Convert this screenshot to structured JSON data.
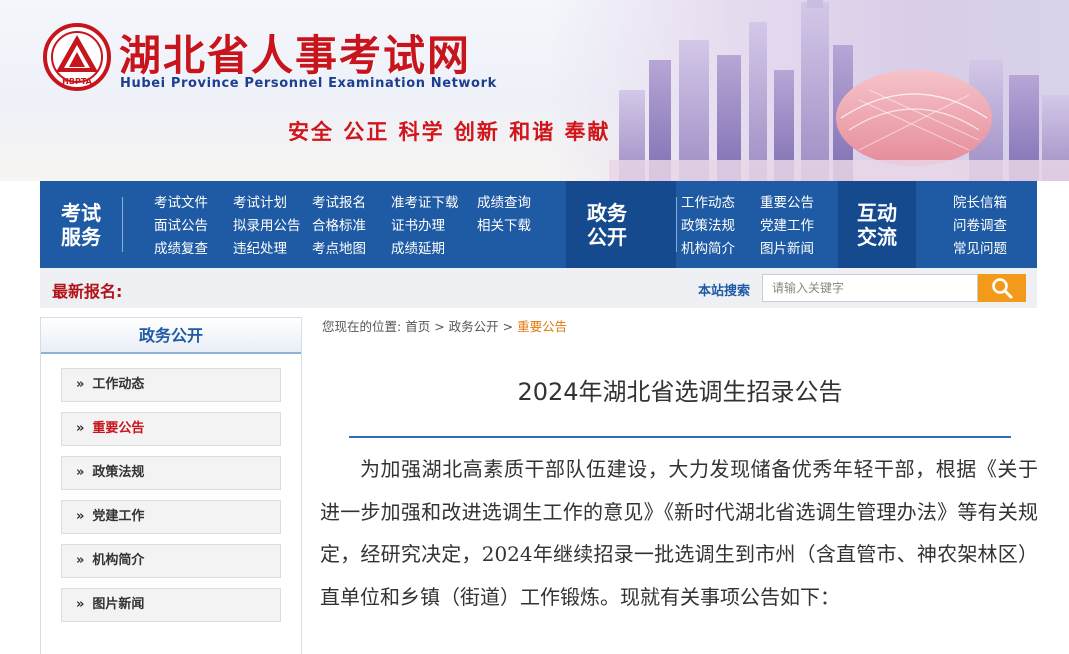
{
  "header": {
    "title": "湖北省人事考试网",
    "subtitle": "Hubei Province Personnel Examination Network",
    "logo_text": "HBPTA",
    "slogan": "安全 公正 科学 创新 和谐 奉献"
  },
  "nav": {
    "sections": [
      {
        "head_line1": "考试",
        "head_line2": "服务",
        "links": [
          "考试文件",
          "考试计划",
          "考试报名",
          "准考证下载",
          "成绩查询",
          "面试公告",
          "拟录用公告",
          "合格标准",
          "证书办理",
          "相关下载",
          "成绩复查",
          "违纪处理",
          "考点地图",
          "成绩延期"
        ]
      },
      {
        "head_line1": "政务",
        "head_line2": "公开",
        "links": [
          "工作动态",
          "重要公告",
          "政策法规",
          "党建工作",
          "机构简介",
          "图片新闻"
        ]
      },
      {
        "head_line1": "互动",
        "head_line2": "交流",
        "links": [
          "院长信箱",
          "问卷调查",
          "常见问题"
        ]
      }
    ]
  },
  "notice_bar": {
    "label": "最新报名:",
    "search_label": "本站搜索",
    "search_placeholder": "请输入关键字",
    "search_value": ""
  },
  "sidebar": {
    "title": "政务公开",
    "items": [
      {
        "label": "工作动态",
        "active": false
      },
      {
        "label": "重要公告",
        "active": true
      },
      {
        "label": "政策法规",
        "active": false
      },
      {
        "label": "党建工作",
        "active": false
      },
      {
        "label": "机构简介",
        "active": false
      },
      {
        "label": "图片新闻",
        "active": false
      }
    ]
  },
  "breadcrumb": {
    "prefix": "您现在的位置:",
    "items": [
      "首页",
      "政务公开",
      "重要公告"
    ],
    "separator": ">"
  },
  "article": {
    "title": "2024年湖北省选调生招录公告",
    "body": "为加强湖北高素质干部队伍建设，大力发现储备优秀年轻干部，根据《关于进一步加强和改进选调生工作的意见》《新时代湖北省选调生管理办法》等有关规定，经研究决定，2024年继续招录一批选调生到市州（含直管市、神农架林区）直单位和乡镇（街道）工作锻炼。现就有关事项公告如下："
  },
  "colors": {
    "brand_red": "#c8141c",
    "nav_blue": "#1f5aa4",
    "search_orange": "#f39a1a",
    "breadcrumb_current": "#e07a10"
  },
  "icons": {
    "logo": "hbpta-emblem-icon",
    "search": "search-icon",
    "sidebar_arrow": "double-chevron-right-icon"
  }
}
